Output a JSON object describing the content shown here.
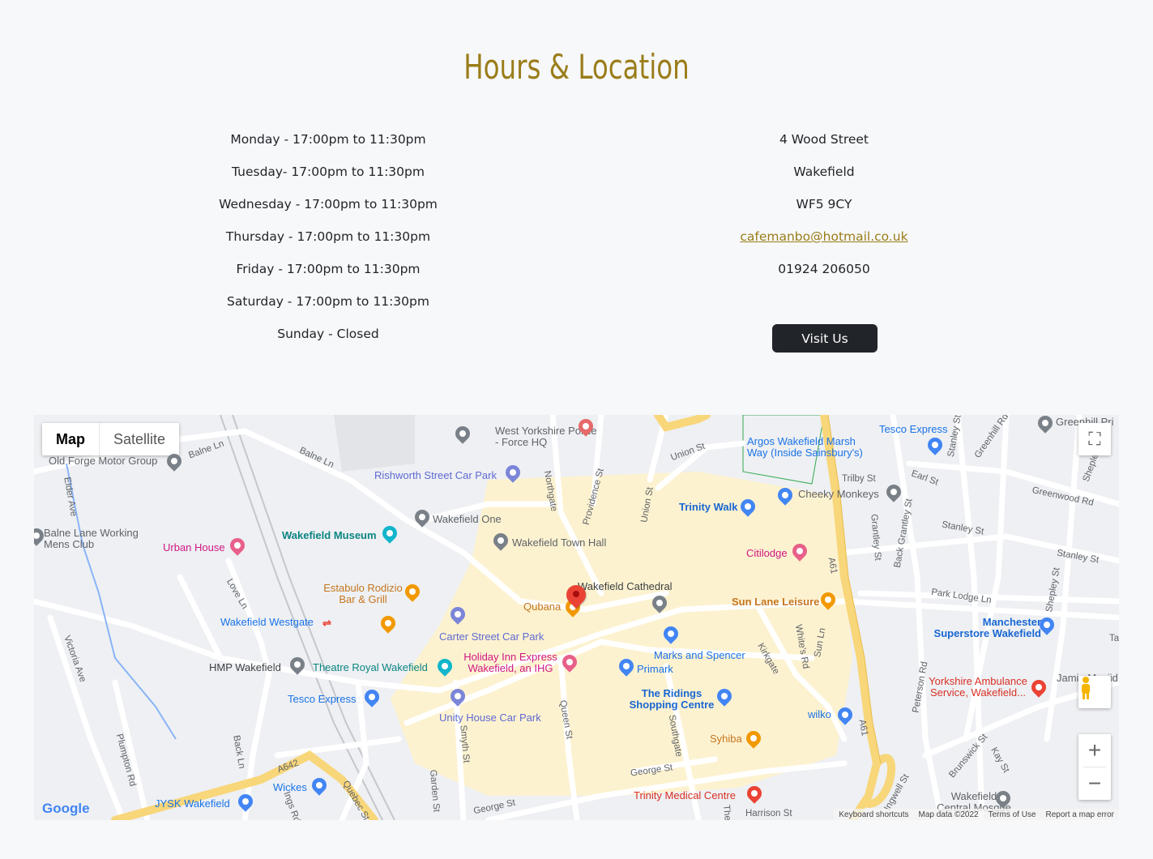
{
  "section": {
    "title": "Hours & Location"
  },
  "hours": [
    "Monday - 17:00pm to 11:30pm",
    "Tuesday- 17:00pm to 11:30pm",
    "Wednesday - 17:00pm to 11:30pm",
    "Thursday - 17:00pm to 11:30pm",
    "Friday - 17:00pm to 11:30pm",
    "Saturday - 17:00pm to 11:30pm",
    "Sunday - Closed"
  ],
  "location": {
    "street": "4 Wood Street",
    "city": "Wakefield",
    "postcode": "WF5 9CY",
    "email": "cafemanbo@hotmail.co.uk",
    "phone": "01924 206050",
    "visit_label": "Visit Us"
  },
  "map": {
    "type_map": "Map",
    "type_satellite": "Satellite",
    "logo": "Google",
    "footer": [
      "Keyboard shortcuts",
      "Map data ©2022",
      "Terms of Use",
      "Report a map error"
    ],
    "zoom_in": "+",
    "zoom_out": "−",
    "places": {
      "west_yorkshire_police": "West Yorkshire Police - Force HQ",
      "tesco_express_ne": "Tesco Express",
      "argos": "Argos Wakefield Marsh Way (Inside Sainsbury's)",
      "greenhill": "Greenhill Pri",
      "old_forge": "Old Forge Motor Group",
      "rishworth": "Rishworth Street Car Park",
      "cheeky_monkeys": "Cheeky Monkeys",
      "trinity_walk": "Trinity Walk",
      "wakefield_one": "Wakefield One",
      "balne_lane_club": "Balne Lane Working Mens Club",
      "wakefield_museum": "Wakefield Museum",
      "town_hall": "Wakefield Town Hall",
      "urban_house": "Urban House",
      "citilodge": "Citilodge",
      "estabulo": "Estabulo Rodizio Bar & Grill",
      "wakefield_cathedral": "Wakefield Cathedral",
      "qubana": "Qubana",
      "sun_lane": "Sun Lane Leisure",
      "manchester_superstore": "Manchester Superstore Wakefield",
      "westgate": "Wakefield Westgate",
      "carter_street": "Carter Street Car Park",
      "holiday_inn": "Holiday Inn Express Wakefield, an IHG",
      "marks_spencer": "Marks and Spencer",
      "primark": "Primark",
      "hmp": "HMP Wakefield",
      "theatre_royal": "Theatre Royal Wakefield",
      "yorkshire_ambulance": "Yorkshire Ambulance Service, Wakefield...",
      "jamia": "Jamia Masjid",
      "ridings": "The Ridings Shopping Centre",
      "tesco_express_sw": "Tesco Express",
      "unity_house": "Unity House Car Park",
      "wilko": "wilko",
      "syhiba": "Syhiba",
      "trinity_medical": "Trinity Medical Centre",
      "wickes": "Wickes",
      "jysk": "JYSK Wakefield",
      "central_mosque": "Wakefield Central Mosque"
    },
    "streets": {
      "balne_ln_1": "Balne Ln",
      "balne_ln_2": "Balne Ln",
      "elder_ave": "Elder Ave",
      "northgate": "Northgate",
      "providence_st": "Providence St",
      "union_st_1": "Union St",
      "union_st_2": "Union St",
      "trilby_st": "Trilby St",
      "earl_st": "Earl St",
      "greenhill_rd": "Greenhill Rd",
      "stanley_1": "Stanley St",
      "greenwood_rd": "Greenwood Rd",
      "shepley_st_1": "Shepley St",
      "granley_st": "Grantley St",
      "back_grantley_st": "Back Grantley St",
      "stanley_2": "Stanley St",
      "stanley_3": "Stanley St",
      "park_lodge_ln": "Park Lodge Ln",
      "shepley_st_2": "Shepley St",
      "a61_1": "A61",
      "a61_2": "A61",
      "love_ln": "Love Ln",
      "victoria_ave": "Victoria Ave",
      "kirkgate": "Kirkgate",
      "whites_rd": "White's Rd",
      "sun_ln": "Sun Ln",
      "peterson_rd": "Peterson Rd",
      "queen_st": "Queen St",
      "smyth_st": "Smyth St",
      "southgate": "Southgate",
      "plumpton_rd": "Plumpton Rd",
      "back_ln": "Back Ln",
      "a642": "A642",
      "quebec_st": "Quebec St",
      "ings_rd": "Ings Rd",
      "garden_st": "Garden St",
      "george_st_1": "George St",
      "george_st_2": "George St",
      "brunswick_st": "Brunswick St",
      "kay_st": "Kay St",
      "ingwell_st": "Ingwell St",
      "harrison_st": "Harrison St",
      "the": "The",
      "ta": "Ta"
    }
  }
}
